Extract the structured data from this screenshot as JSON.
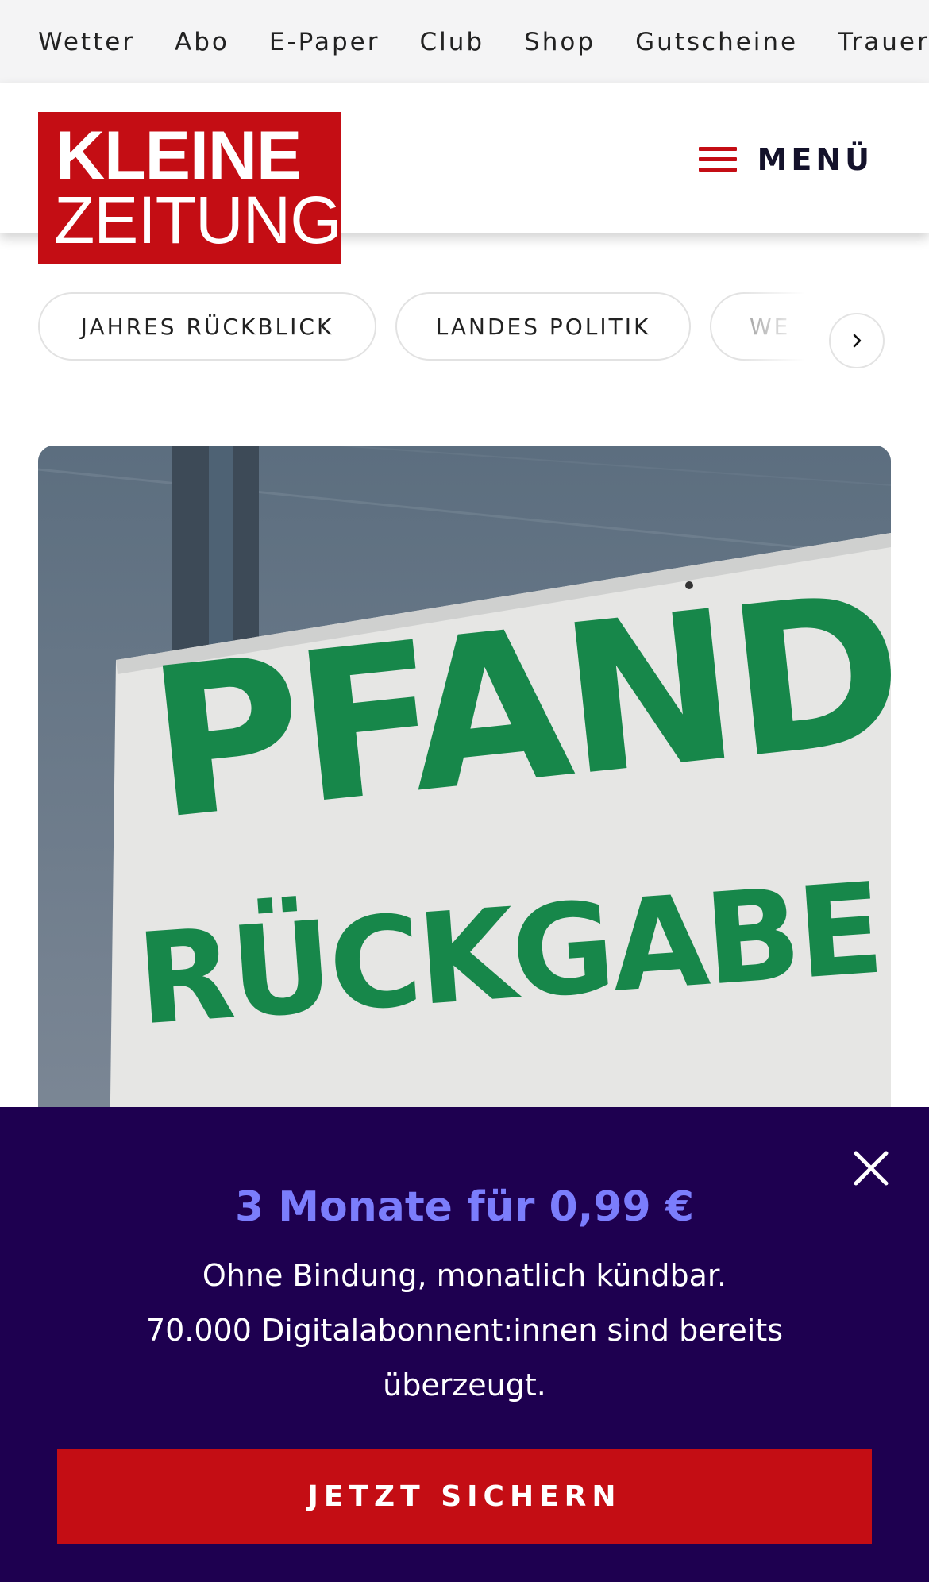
{
  "topnav": {
    "links": [
      "Wetter",
      "Abo",
      "E-Paper",
      "Club",
      "Shop",
      "Gutscheine",
      "Trauerp"
    ]
  },
  "header": {
    "logo_line1": "KLEINE",
    "logo_line2": "ZEITUNG",
    "menu_label": "MENÜ"
  },
  "categories": [
    "JAHRES RÜCKBLICK",
    "LANDES POLITIK",
    "WE"
  ],
  "hero": {
    "sign_line1": "PFAND",
    "sign_line2": "RÜCKGABE"
  },
  "offer": {
    "headline": "3 Monate für 0,99 €",
    "line1": "Ohne Bindung, monatlich kündbar.",
    "line2": "70.000 Digitalabonnent:innen sind bereits überzeugt.",
    "cta": "JETZT SICHERN"
  },
  "colors": {
    "brand_red": "#c40d14",
    "overlay_bg": "#1e0050",
    "offer_accent": "#7b7dfc",
    "sign_green": "#17874a"
  },
  "icons": {
    "menu": "hamburger-icon",
    "scroll": "chevron-right-icon",
    "close": "close-icon"
  }
}
